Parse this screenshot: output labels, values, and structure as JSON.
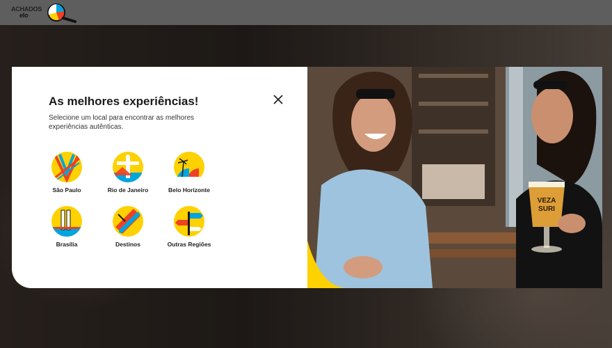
{
  "brand": {
    "line1": "ACHADOS",
    "line2": "elo",
    "colors": {
      "yellow": "#fed100",
      "blue": "#00a4e0",
      "red": "#ef4123",
      "dark": "#1a1a1a"
    }
  },
  "modal": {
    "title": "As melhores experiências!",
    "description": "Selecione um local para encontrar as melhores experiências autênticas.",
    "close_icon": "close-icon",
    "cities": [
      {
        "label": "São Paulo",
        "icon": "sao-paulo-icon"
      },
      {
        "label": "Rio de Janeiro",
        "icon": "rio-de-janeiro-icon"
      },
      {
        "label": "Belo Horizonte",
        "icon": "belo-horizonte-icon"
      },
      {
        "label": "Brasília",
        "icon": "brasilia-icon"
      },
      {
        "label": "Destinos",
        "icon": "destinos-icon"
      },
      {
        "label": "Outras Regiões",
        "icon": "outras-regioes-icon"
      }
    ],
    "photo": {
      "beer_label_line1": "VEZA",
      "beer_label_line2": "SURI"
    }
  }
}
